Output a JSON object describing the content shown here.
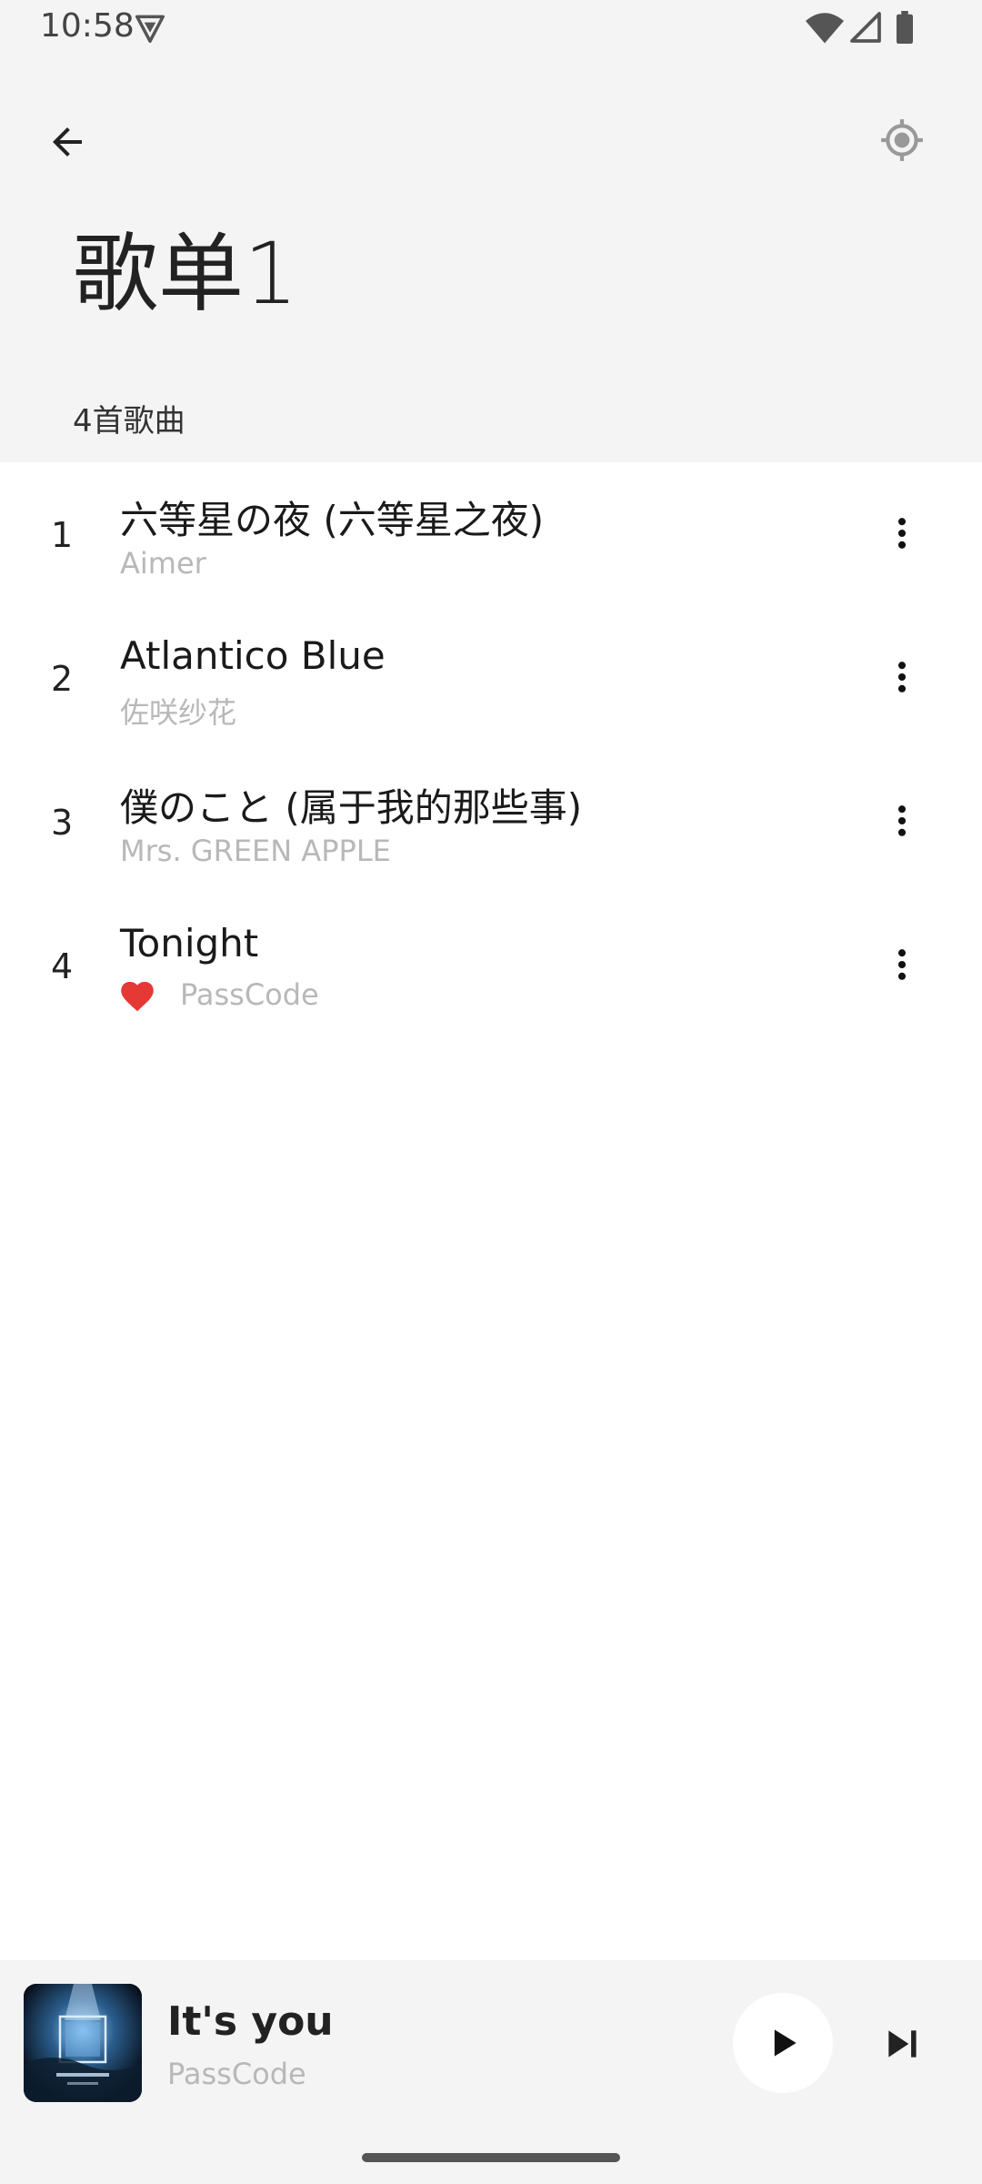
{
  "status_bar": {
    "time": "10:58",
    "icons": [
      "vpn-shield-icon",
      "wifi-icon",
      "cell-signal-icon",
      "battery-icon"
    ]
  },
  "header": {
    "back_icon": "arrow-left-icon",
    "locate_icon": "locate-crosshair-icon",
    "title": "歌单1",
    "song_count": "4首歌曲"
  },
  "songs": [
    {
      "index": "1",
      "title": "六等星の夜 (六等星之夜)",
      "artist": "Aimer",
      "favorite": false
    },
    {
      "index": "2",
      "title": "Atlantico Blue",
      "artist": "佐咲纱花",
      "favorite": false
    },
    {
      "index": "3",
      "title": "僕のこと (属于我的那些事)",
      "artist": "Mrs. GREEN APPLE",
      "favorite": false
    },
    {
      "index": "4",
      "title": "Tonight",
      "artist": "PassCode",
      "favorite": true
    }
  ],
  "now_playing": {
    "title": "It's you",
    "artist": "PassCode",
    "play_icon": "play-icon",
    "next_icon": "skip-next-icon"
  },
  "colors": {
    "header_bg": "#f4f4f4",
    "list_bg": "#ffffff",
    "secondary_text": "#b8b8b8",
    "heart": "#e53935"
  }
}
